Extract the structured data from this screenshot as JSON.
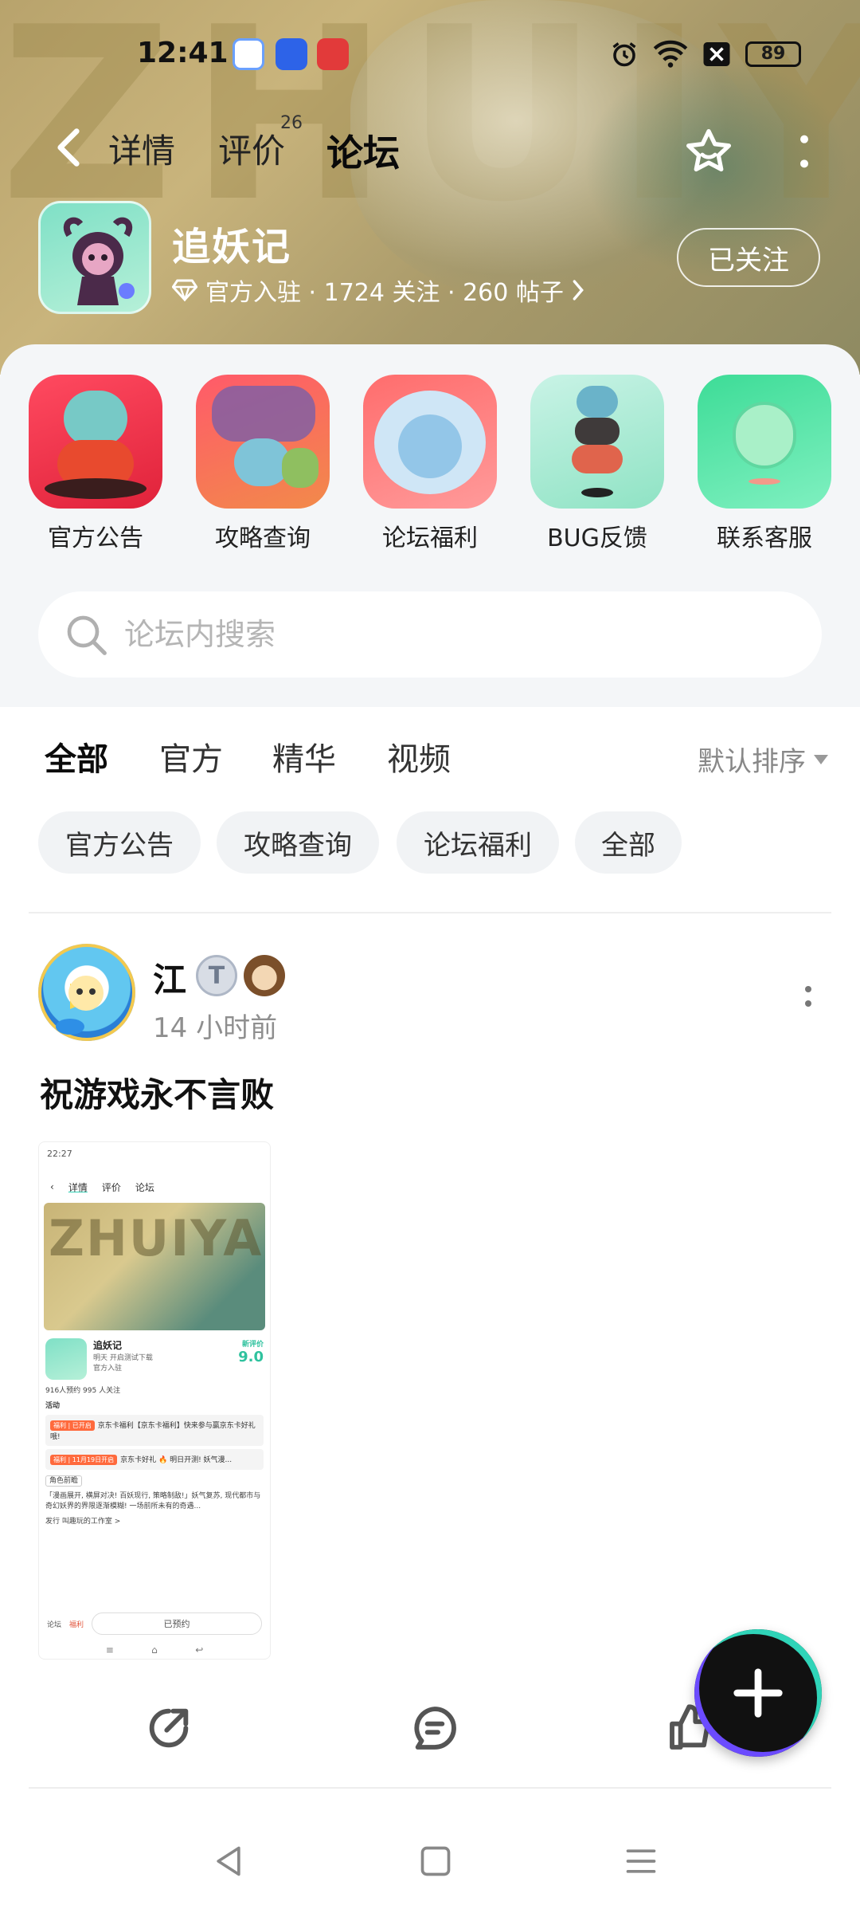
{
  "status_bar": {
    "time": "12:41",
    "battery": "89",
    "icons": [
      "alarm-icon",
      "wifi-icon",
      "signal-off-icon",
      "battery-icon"
    ]
  },
  "top_nav": {
    "tabs": [
      {
        "label": "详情",
        "active": false
      },
      {
        "label": "评价",
        "badge": "26",
        "active": false
      },
      {
        "label": "论坛",
        "active": true
      }
    ]
  },
  "game": {
    "title": "追妖记",
    "meta": "官方入驻 · 1724 关注 · 260 帖子",
    "follow_label": "已关注"
  },
  "shortcuts": [
    {
      "label": "官方公告"
    },
    {
      "label": "攻略查询"
    },
    {
      "label": "论坛福利"
    },
    {
      "label": "BUG反馈"
    },
    {
      "label": "联系客服"
    }
  ],
  "search": {
    "placeholder": "论坛内搜索"
  },
  "filter_tabs": [
    {
      "label": "全部",
      "active": true
    },
    {
      "label": "官方",
      "active": false
    },
    {
      "label": "精华",
      "active": false
    },
    {
      "label": "视频",
      "active": false
    }
  ],
  "sort_label": "默认排序",
  "chips": [
    "官方公告",
    "攻略查询",
    "论坛福利",
    "全部"
  ],
  "post": {
    "username": "江",
    "time": "14 小时前",
    "text": "祝游戏永不言败",
    "thumb": {
      "status_time": "22:27",
      "nav": [
        "详情",
        "评价",
        "论坛"
      ],
      "banner_text": "ZHUIYAO",
      "game_title": "追妖记",
      "game_sub": "明天 开启测试下载",
      "official": "官方入驻",
      "score_label": "新评价",
      "score": "9.0",
      "stats": "916人预约    995 人关注",
      "activity_label": "活动",
      "card1_tag": "福利 | 已开启",
      "card1": "京东卡福利【京东卡福利】快来参与赢京东卡好礼哦!",
      "card2_tag": "福利 | 11月19日开启",
      "card2": "京东卡好礼 🔥 明日开测! 妖气漫...",
      "tag": "角色前瞻",
      "desc": "「漫画展开, 横屏对决! 百妖现行, 策略制敌!」妖气复苏, 现代都市与奇幻妖界的界限逐渐模糊! 一场前所未有的奇遇...",
      "publisher": "发行  叫趣玩的工作室 >",
      "reserved_label": "已预约",
      "bottom_left": "论坛",
      "bottom_mid": "福利"
    }
  },
  "colors": {
    "accent": "#2fd4b8",
    "banner": "#b8a36c",
    "panel": "#f4f6f8"
  }
}
